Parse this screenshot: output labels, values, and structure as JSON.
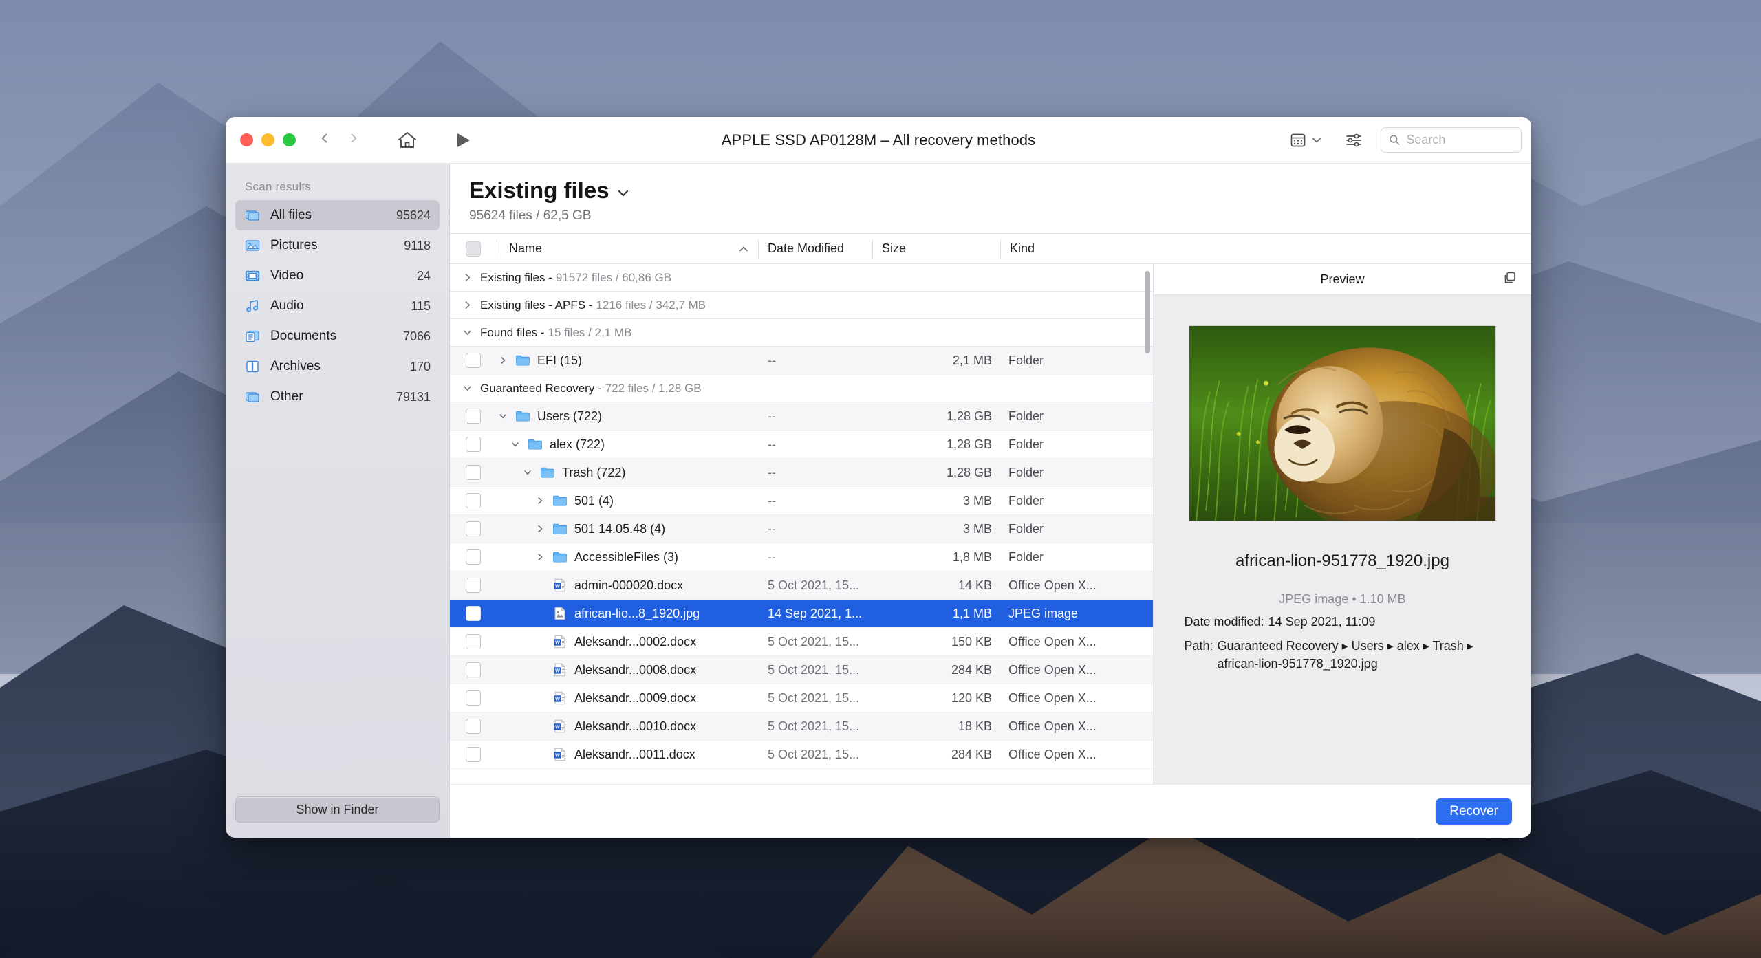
{
  "window": {
    "title": "APPLE SSD AP0128M – All recovery methods",
    "traffic_lights": [
      "close",
      "minimize",
      "zoom"
    ]
  },
  "toolbar": {
    "back_label": "Back",
    "forward_label": "Forward",
    "home_label": "Home",
    "play_label": "Start scan",
    "view_mode_label": "View options",
    "filter_label": "Filter options",
    "search_placeholder": "Search",
    "search_value": ""
  },
  "sidebar": {
    "section_title": "Scan results",
    "items": [
      {
        "label": "All files",
        "count": "95624",
        "icon": "all-files-icon",
        "selected": true
      },
      {
        "label": "Pictures",
        "count": "9118",
        "icon": "pictures-icon",
        "selected": false
      },
      {
        "label": "Video",
        "count": "24",
        "icon": "video-icon",
        "selected": false
      },
      {
        "label": "Audio",
        "count": "115",
        "icon": "audio-icon",
        "selected": false
      },
      {
        "label": "Documents",
        "count": "7066",
        "icon": "documents-icon",
        "selected": false
      },
      {
        "label": "Archives",
        "count": "170",
        "icon": "archives-icon",
        "selected": false
      },
      {
        "label": "Other",
        "count": "79131",
        "icon": "other-icon",
        "selected": false
      }
    ],
    "show_in_finder_label": "Show in Finder"
  },
  "main": {
    "heading": "Existing files",
    "heading_chevron": "chevron-down-icon",
    "subheading": "95624 files / 62,5 GB",
    "columns": [
      {
        "key": "check",
        "label": ""
      },
      {
        "key": "name",
        "label": "Name",
        "sorted": "asc"
      },
      {
        "key": "date",
        "label": "Date Modified"
      },
      {
        "key": "size",
        "label": "Size"
      },
      {
        "key": "kind",
        "label": "Kind"
      }
    ],
    "rows": [
      {
        "type": "group",
        "expanded": false,
        "name": "Existing files -",
        "meta": "91572 files / 60,86 GB"
      },
      {
        "type": "group",
        "expanded": false,
        "name": "Existing files - APFS -",
        "meta": "1216 files / 342,7 MB"
      },
      {
        "type": "group",
        "expanded": true,
        "name": "Found files -",
        "meta": "15 files / 2,1 MB"
      },
      {
        "type": "file",
        "indent": 0,
        "twisty": "collapsed",
        "icon": "folder-icon",
        "name": "EFI (15)",
        "date": "--",
        "size": "2,1 MB",
        "kind": "Folder",
        "alt": true,
        "selected": false
      },
      {
        "type": "group",
        "expanded": true,
        "name": "Guaranteed Recovery -",
        "meta": "722 files / 1,28 GB"
      },
      {
        "type": "file",
        "indent": 0,
        "twisty": "expanded",
        "icon": "folder-icon",
        "name": "Users (722)",
        "date": "--",
        "size": "1,28 GB",
        "kind": "Folder",
        "alt": true,
        "selected": false
      },
      {
        "type": "file",
        "indent": 1,
        "twisty": "expanded",
        "icon": "folder-icon",
        "name": "alex (722)",
        "date": "--",
        "size": "1,28 GB",
        "kind": "Folder",
        "alt": false,
        "selected": false
      },
      {
        "type": "file",
        "indent": 2,
        "twisty": "expanded",
        "icon": "folder-icon",
        "name": "Trash (722)",
        "date": "--",
        "size": "1,28 GB",
        "kind": "Folder",
        "alt": true,
        "selected": false
      },
      {
        "type": "file",
        "indent": 3,
        "twisty": "collapsed",
        "icon": "folder-icon",
        "name": "501 (4)",
        "date": "--",
        "size": "3 MB",
        "kind": "Folder",
        "alt": false,
        "selected": false
      },
      {
        "type": "file",
        "indent": 3,
        "twisty": "collapsed",
        "icon": "folder-icon",
        "name": "501 14.05.48 (4)",
        "date": "--",
        "size": "3 MB",
        "kind": "Folder",
        "alt": true,
        "selected": false
      },
      {
        "type": "file",
        "indent": 3,
        "twisty": "collapsed",
        "icon": "folder-icon",
        "name": "AccessibleFiles (3)",
        "date": "--",
        "size": "1,8 MB",
        "kind": "Folder",
        "alt": false,
        "selected": false
      },
      {
        "type": "file",
        "indent": 3,
        "twisty": "none",
        "icon": "docx-icon",
        "name": "admin-000020.docx",
        "date": "5 Oct 2021, 15...",
        "size": "14 KB",
        "kind": "Office Open X...",
        "alt": true,
        "selected": false
      },
      {
        "type": "file",
        "indent": 3,
        "twisty": "none",
        "icon": "jpeg-icon",
        "name": "african-lio...8_1920.jpg",
        "date": "14 Sep 2021, 1...",
        "size": "1,1 MB",
        "kind": "JPEG image",
        "alt": false,
        "selected": true
      },
      {
        "type": "file",
        "indent": 3,
        "twisty": "none",
        "icon": "docx-icon",
        "name": "Aleksandr...0002.docx",
        "date": "5 Oct 2021, 15...",
        "size": "150 KB",
        "kind": "Office Open X...",
        "alt": false,
        "selected": false
      },
      {
        "type": "file",
        "indent": 3,
        "twisty": "none",
        "icon": "docx-icon",
        "name": "Aleksandr...0008.docx",
        "date": "5 Oct 2021, 15...",
        "size": "284 KB",
        "kind": "Office Open X...",
        "alt": true,
        "selected": false
      },
      {
        "type": "file",
        "indent": 3,
        "twisty": "none",
        "icon": "docx-icon",
        "name": "Aleksandr...0009.docx",
        "date": "5 Oct 2021, 15...",
        "size": "120 KB",
        "kind": "Office Open X...",
        "alt": false,
        "selected": false
      },
      {
        "type": "file",
        "indent": 3,
        "twisty": "none",
        "icon": "docx-icon",
        "name": "Aleksandr...0010.docx",
        "date": "5 Oct 2021, 15...",
        "size": "18 KB",
        "kind": "Office Open X...",
        "alt": true,
        "selected": false
      },
      {
        "type": "file",
        "indent": 3,
        "twisty": "none",
        "icon": "docx-icon",
        "name": "Aleksandr...0011.docx",
        "date": "5 Oct 2021, 15...",
        "size": "284 KB",
        "kind": "Office Open X...",
        "alt": false,
        "selected": false
      }
    ]
  },
  "preview": {
    "header": "Preview",
    "detach_icon": "open-in-new-window-icon",
    "image_alt": "african lion lying in green grass",
    "filename": "african-lion-951778_1920.jpg",
    "kind_and_size": "JPEG image • 1.10 MB",
    "date_key": "Date modified:",
    "date_value": "14 Sep 2021, 11:09",
    "path_key": "Path:",
    "path_value": "Guaranteed Recovery ▸ Users ▸ alex ▸ Trash ▸ african-lion-951778_1920.jpg"
  },
  "footer": {
    "recover_label": "Recover"
  },
  "colors": {
    "accent": "#2b6ef0",
    "selection": "#1f5fe0",
    "sidebar_bg": "#e2e3e9",
    "folder_blue": "#58a8ef",
    "traffic_red": "#ff5f57",
    "traffic_yellow": "#febc2e",
    "traffic_green": "#28c840"
  }
}
